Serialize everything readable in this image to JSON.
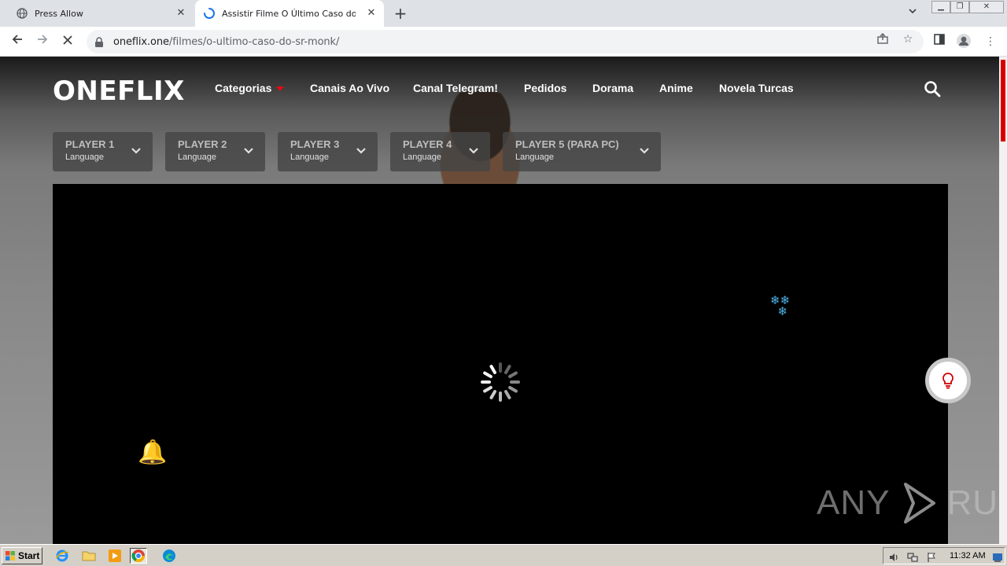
{
  "browser": {
    "tabs": [
      {
        "title": "Press Allow",
        "favicon": "globe-icon",
        "active": false
      },
      {
        "title": "Assistir Filme O Último Caso do Sr. Monk",
        "favicon": "loading-spinner-icon",
        "active": true
      }
    ],
    "new_tab_label": "+",
    "close_label": "✕",
    "url_host": "oneflix.one",
    "url_path": "/filmes/o-ultimo-caso-do-sr-monk/",
    "loading": true
  },
  "site": {
    "logo": "ONEFLIX",
    "nav": [
      {
        "label": "Categorias",
        "has_dropdown": true
      },
      {
        "label": "Canais Ao Vivo"
      },
      {
        "label": "Canal Telegram!"
      },
      {
        "label": "Pedidos"
      },
      {
        "label": "Dorama"
      },
      {
        "label": "Anime"
      },
      {
        "label": "Novela Turcas"
      }
    ],
    "players": [
      {
        "label": "PLAYER 1",
        "sub": "Language"
      },
      {
        "label": "PLAYER 2",
        "sub": "Language"
      },
      {
        "label": "PLAYER 3",
        "sub": "Language"
      },
      {
        "label": "PLAYER 4",
        "sub": "Language"
      },
      {
        "label": "PLAYER 5 (PARA PC)",
        "sub": "Language"
      }
    ],
    "watermark_left": "ANY",
    "watermark_right": "RUN",
    "accent": "#e50914"
  },
  "taskbar": {
    "start_label": "Start",
    "apps": [
      "ie-icon",
      "folder-icon",
      "media-player-icon",
      "chrome-icon",
      "edge-icon"
    ],
    "clock": "11:32 AM"
  }
}
